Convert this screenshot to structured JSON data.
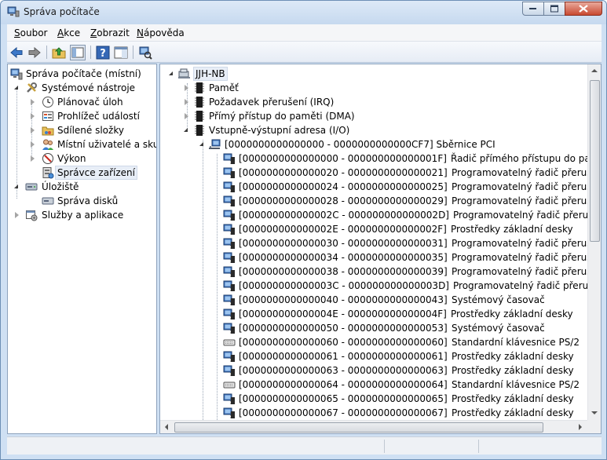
{
  "window": {
    "title": "Správa počítače"
  },
  "menu": [
    "Soubor",
    "Akce",
    "Zobrazit",
    "Nápověda"
  ],
  "toolbar": {
    "icons": [
      "back-arrow-icon",
      "forward-arrow-icon",
      "up-folder-icon",
      "show-hide-tree-icon",
      "help-icon",
      "action-pane-icon",
      "scan-hardware-icon"
    ]
  },
  "left_tree": {
    "root": "Správa počítače (místní)",
    "system_tools": "Systémové nástroje",
    "task_scheduler": "Plánovač úloh",
    "event_viewer": "Prohlížeč událostí",
    "shared_folders": "Sdílené složky",
    "local_users": "Místní uživatelé a skupiny",
    "performance": "Výkon",
    "device_manager": "Správce zařízení",
    "storage": "Úložiště",
    "disk_management": "Správa disků",
    "services": "Služby a aplikace"
  },
  "device_tree": {
    "root": "JJH-NB",
    "memory": "Paměť",
    "irq": "Požadavek přerušení (IRQ)",
    "dma": "Přímý přístup do paměti (DMA)",
    "io": "Vstupně-výstupní adresa (I/O)",
    "pci_bus": "[0000000000000000 - 0000000000000CF7]  Sběrnice PCI",
    "io_entries": [
      {
        "range": "[0000000000000000 - 000000000000001F]",
        "name": "Řadič přímého přístupu do paměti (DMA)"
      },
      {
        "range": "[0000000000000020 - 0000000000000021]",
        "name": "Programovatelný řadič přerušení"
      },
      {
        "range": "[0000000000000024 - 0000000000000025]",
        "name": "Programovatelný řadič přerušení"
      },
      {
        "range": "[0000000000000028 - 0000000000000029]",
        "name": "Programovatelný řadič přerušení"
      },
      {
        "range": "[000000000000002C - 000000000000002D]",
        "name": "Programovatelný řadič přerušení"
      },
      {
        "range": "[000000000000002E - 000000000000002F]",
        "name": "Prostředky základní desky"
      },
      {
        "range": "[0000000000000030 - 0000000000000031]",
        "name": "Programovatelný řadič přerušení"
      },
      {
        "range": "[0000000000000034 - 0000000000000035]",
        "name": "Programovatelný řadič přerušení"
      },
      {
        "range": "[0000000000000038 - 0000000000000039]",
        "name": "Programovatelný řadič přerušení"
      },
      {
        "range": "[000000000000003C - 000000000000003D]",
        "name": "Programovatelný řadič přerušení"
      },
      {
        "range": "[0000000000000040 - 0000000000000043]",
        "name": "Systémový časovač"
      },
      {
        "range": "[000000000000004E - 000000000000004F]",
        "name": "Prostředky základní desky"
      },
      {
        "range": "[0000000000000050 - 0000000000000053]",
        "name": "Systémový časovač"
      },
      {
        "range": "[0000000000000060 - 0000000000000060]",
        "name": "Standardní klávesnice PS/2"
      },
      {
        "range": "[0000000000000061 - 0000000000000061]",
        "name": "Prostředky základní desky"
      },
      {
        "range": "[0000000000000063 - 0000000000000063]",
        "name": "Prostředky základní desky"
      },
      {
        "range": "[0000000000000064 - 0000000000000064]",
        "name": "Standardní klávesnice PS/2"
      },
      {
        "range": "[0000000000000065 - 0000000000000065]",
        "name": "Prostředky základní desky"
      },
      {
        "range": "[0000000000000067 - 0000000000000067]",
        "name": "Prostředky základní desky"
      }
    ],
    "entry_icons": [
      "chip-icon",
      "chip-icon",
      "chip-icon",
      "chip-icon",
      "chip-icon",
      "chip-icon",
      "chip-icon",
      "chip-icon",
      "chip-icon",
      "chip-icon",
      "chip-icon",
      "chip-icon",
      "chip-icon",
      "keyboard-icon",
      "chip-icon",
      "chip-icon",
      "keyboard-icon",
      "chip-icon",
      "chip-icon"
    ]
  }
}
